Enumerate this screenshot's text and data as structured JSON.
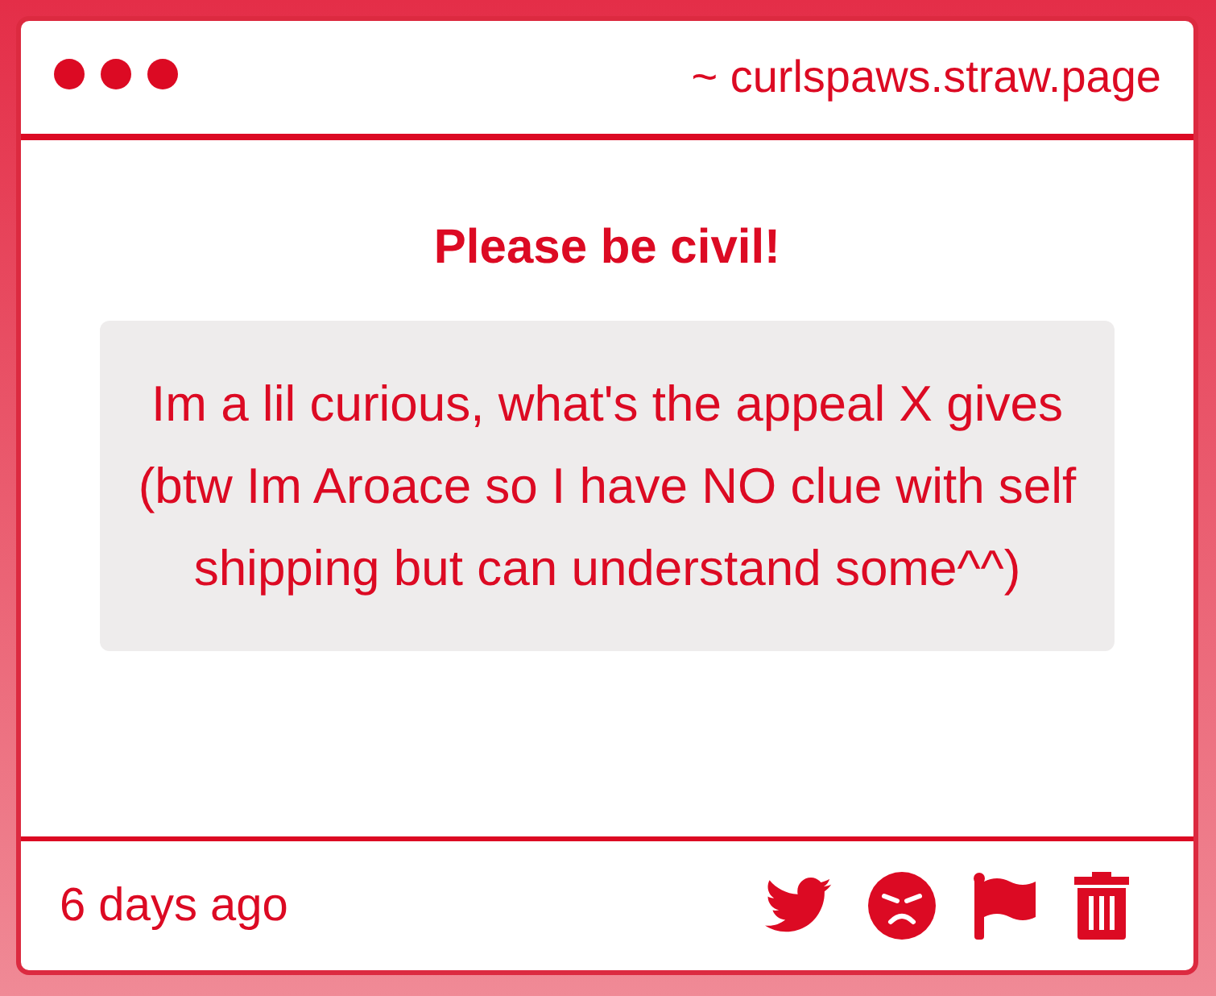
{
  "window": {
    "address": "~ curlspaws.straw.page"
  },
  "notice": "Please be civil!",
  "message": "Im a lil curious, what's the appeal X gives (btw Im Aroace so I have NO clue with self shipping but can understand some^^)",
  "footer": {
    "time": "6 days ago"
  }
}
